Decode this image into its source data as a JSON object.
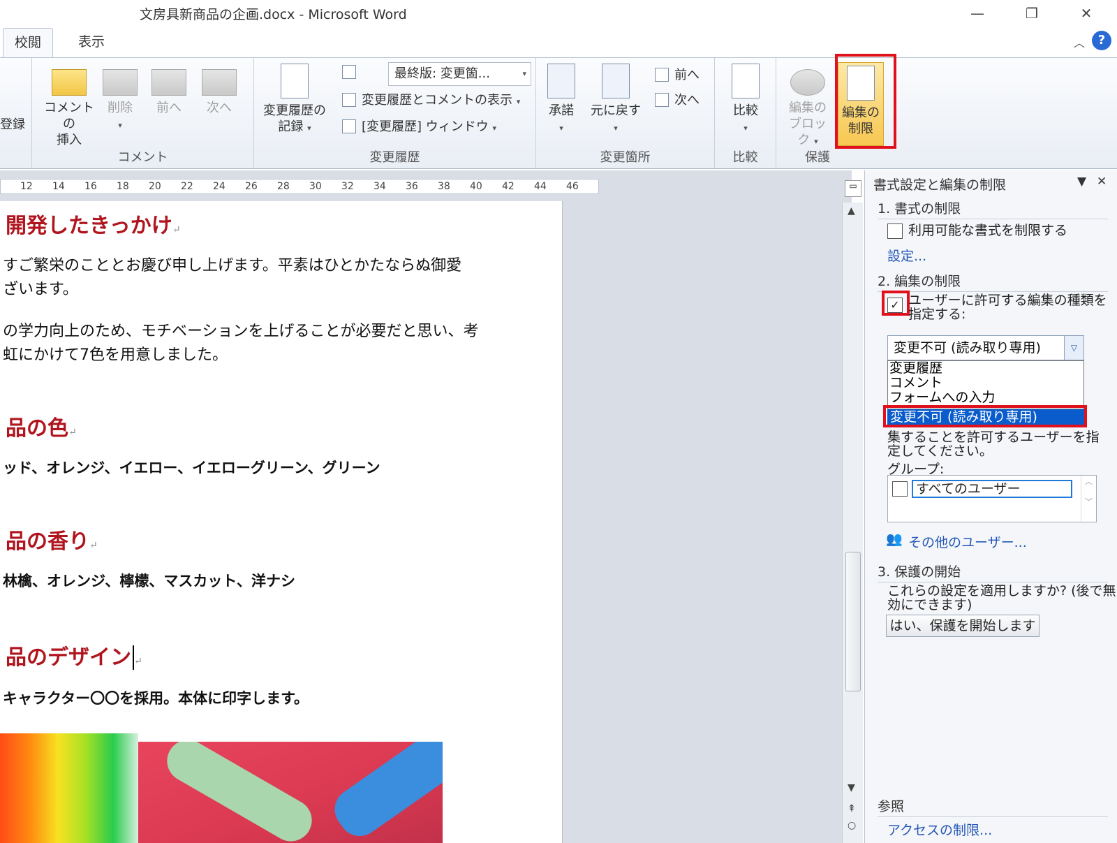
{
  "window": {
    "title": "文房具新商品の企画.docx - Microsoft Word",
    "controls": [
      "—",
      "❐",
      "✕"
    ]
  },
  "tabs": [
    {
      "label": "校閲",
      "active": true
    },
    {
      "label": "表示",
      "active": false
    }
  ],
  "ribbon": {
    "partial_label": "登録",
    "comment_group": {
      "label": "コメント",
      "insert_line1": "コメントの",
      "insert_line2": "挿入",
      "delete": "削除",
      "prev": "前へ",
      "next": "次へ"
    },
    "tracking_group": {
      "label": "変更履歴",
      "record_line1": "変更履歴の",
      "record_line2": "記録",
      "display_combo": "最終版: 変更箇...",
      "show_markup": "変更履歴とコメントの表示",
      "review_pane": "[変更履歴] ウィンドウ"
    },
    "changes_group": {
      "label": "変更箇所",
      "accept": "承諾",
      "reject": "元に戻す",
      "prev": "前へ",
      "next": "次へ"
    },
    "compare_group": {
      "label": "比較",
      "compare": "比較"
    },
    "protect_group": {
      "label": "保護",
      "block_line1": "編集の",
      "block_line2": "ブロック",
      "restrict_line1": "編集の",
      "restrict_line2": "制限"
    }
  },
  "ruler": {
    "ticks": [
      "12",
      "14",
      "16",
      "18",
      "20",
      "22",
      "24",
      "26",
      "28",
      "30",
      "32",
      "34",
      "36",
      "38",
      "40",
      "42",
      "44",
      "46"
    ]
  },
  "document": {
    "heading1": "開発したきっかけ",
    "para1_line1": "すご繁栄のこととお慶び申し上げます。平素はひとかたならぬ御愛",
    "para1_line2": "ざいます。",
    "para2_line1": "の学力向上のため、モチベーションを上げることが必要だと思い、考",
    "para2_line2": "虹にかけて7色を用意しました。",
    "heading2": "品の色",
    "colors": "ッド、オレンジ、イエロー、イエローグリーン、グリーン",
    "heading3": "品の香り",
    "scents": "林檎、オレンジ、檸檬、マスカット、洋ナシ",
    "heading4": "品のデザイン",
    "design": "キャラクター〇〇を採用。本体に印字します。",
    "para_mark": "↵"
  },
  "pane": {
    "title": "書式設定と編集の制限",
    "sec1": "1. 書式の制限",
    "format_limit": "利用可能な書式を制限する",
    "settings_link": "設定...",
    "sec2": "2. 編集の制限",
    "edit_limit_line1": "ユーザーに許可する編集の種類を",
    "edit_limit_line2": "指定する:",
    "dropdown_value": "変更不可 (読み取り専用)",
    "dropdown_options": [
      "変更履歴",
      "コメント",
      "フォームへの入力"
    ],
    "dropdown_selected": "変更不可 (読み取り専用)",
    "exception_line1": "集することを許可するユーザーを指",
    "exception_line2": "定してください。",
    "group_label": "グループ:",
    "all_users": "すべてのユーザー",
    "more_users": "その他のユーザー...",
    "sec3": "3. 保護の開始",
    "apply_line1": "これらの設定を適用しますか? (後で無",
    "apply_line2": "効にできます)",
    "start_button": "はい、保護を開始します",
    "see_also": "参照",
    "access_link": "アクセスの制限..."
  },
  "colors": {
    "heading_red": "#b0151e",
    "highlight_red": "#e0101c",
    "selection_blue": "#0a5ccd",
    "link_blue": "#2457b8"
  }
}
